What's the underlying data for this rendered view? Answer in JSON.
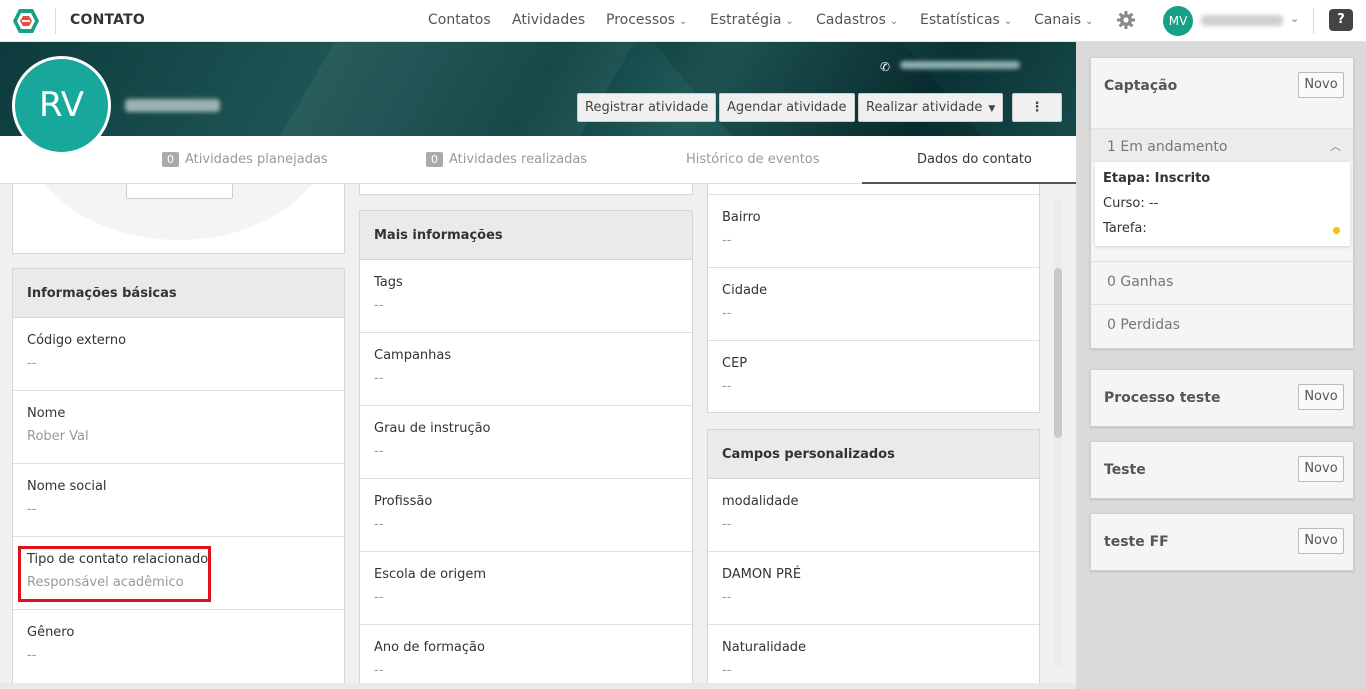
{
  "app": {
    "title": "CONTATO"
  },
  "nav": {
    "items": [
      {
        "label": "Contatos",
        "has_menu": false
      },
      {
        "label": "Atividades",
        "has_menu": false
      },
      {
        "label": "Processos",
        "has_menu": true
      },
      {
        "label": "Estratégia",
        "has_menu": true
      },
      {
        "label": "Cadastros",
        "has_menu": true
      },
      {
        "label": "Estatísticas",
        "has_menu": true
      },
      {
        "label": "Canais",
        "has_menu": true
      }
    ],
    "settings_icon": "gear-icon",
    "user_initials": "MV",
    "help_label": "?"
  },
  "profile": {
    "initials": "RV",
    "actions": {
      "registrar": "Registrar atividade",
      "agendar": "Agendar atividade",
      "realizar": "Realizar atividade",
      "more": "⋮"
    }
  },
  "tabs": {
    "planejadas": {
      "count": "0",
      "label": "Atividades planejadas"
    },
    "realizadas": {
      "count": "0",
      "label": "Atividades realizadas"
    },
    "historico": {
      "label": "Histórico de eventos"
    },
    "dados": {
      "label": "Dados do contato"
    }
  },
  "basic_info": {
    "title": "Informações básicas",
    "fields": [
      {
        "label": "Código externo",
        "value": "--"
      },
      {
        "label": "Nome",
        "value": "Rober Val"
      },
      {
        "label": "Nome social",
        "value": "--"
      },
      {
        "label": "Tipo de contato relacionado",
        "value": "Responsável acadêmico"
      },
      {
        "label": "Gênero",
        "value": "--"
      }
    ]
  },
  "more_info": {
    "title": "Mais informações",
    "fields": [
      {
        "label": "Tags",
        "value": "--"
      },
      {
        "label": "Campanhas",
        "value": "--"
      },
      {
        "label": "Grau de instrução",
        "value": "--"
      },
      {
        "label": "Profissão",
        "value": "--"
      },
      {
        "label": "Escola de origem",
        "value": "--"
      },
      {
        "label": "Ano de formação",
        "value": "--"
      }
    ]
  },
  "address": {
    "fields": [
      {
        "label": "Bairro",
        "value": "--"
      },
      {
        "label": "Cidade",
        "value": "--"
      },
      {
        "label": "CEP",
        "value": "--"
      }
    ]
  },
  "custom_fields": {
    "title": "Campos personalizados",
    "fields": [
      {
        "label": "modalidade",
        "value": "--"
      },
      {
        "label": "DAMON PRÉ",
        "value": "--"
      },
      {
        "label": "Naturalidade",
        "value": "--"
      }
    ]
  },
  "processes": {
    "captacao": {
      "title": "Captação",
      "novo": "Novo",
      "in_progress": "1 Em andamento",
      "detail": {
        "etapa": "Etapa: Inscrito",
        "curso_label": "Curso:",
        "curso_value": "--",
        "tarefa": "Tarefa:"
      },
      "ganhas": "0 Ganhas",
      "perdidas": "0 Perdidas"
    },
    "others": [
      {
        "title": "Processo teste",
        "novo": "Novo"
      },
      {
        "title": "Teste",
        "novo": "Novo"
      },
      {
        "title": "teste FF",
        "novo": "Novo"
      }
    ]
  }
}
